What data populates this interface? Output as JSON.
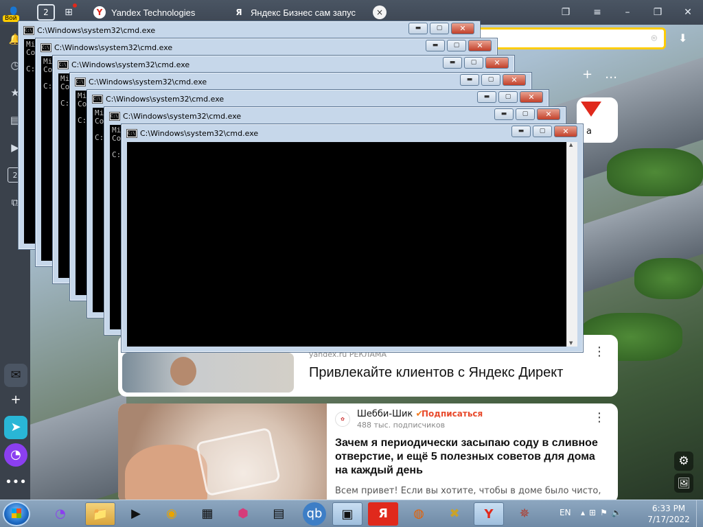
{
  "browser": {
    "tabs": [
      {
        "title": "Yandex Technologies",
        "favicon": "Y"
      },
      {
        "title": "Яндекс Бизнес сам запус",
        "favicon": "Я"
      }
    ],
    "tab_count": "2",
    "profile_badge": "Вой",
    "close_tab_icon": "×"
  },
  "sidebar": {
    "count_badge": "2"
  },
  "cmd_windows": [
    {
      "title": "C:\\Windows\\system32\\cmd.exe",
      "text": "Mi\nCo\n\nC:"
    },
    {
      "title": "C:\\Windows\\system32\\cmd.exe",
      "text": "Mi\nCo\n\nC:"
    },
    {
      "title": "C:\\Windows\\system32\\cmd.exe",
      "text": "Mi\nCo\n\nC:"
    },
    {
      "title": "C:\\Windows\\system32\\cmd.exe",
      "text": "Mi\nCo\n\nC:"
    },
    {
      "title": "C:\\Windows\\system32\\cmd.exe",
      "text": "Mi\nCo\n\nC:"
    },
    {
      "title": "C:\\Windows\\system32\\cmd.exe",
      "text": "Mi\nCo\n\nC:"
    },
    {
      "title": "C:\\Windows\\system32\\cmd.exe",
      "text": ""
    }
  ],
  "zen": {
    "small_card_text": "а",
    "ad": {
      "source": "yandex.ru  РЕКЛАМА",
      "title": "Привлекайте клиентов с Яндекс Директ"
    },
    "article": {
      "channel": "Шебби-Шик",
      "subscribe": "Подписаться",
      "subscribers": "488 тыс. подписчиков",
      "title": "Зачем я периодически засыпаю соду в сливное отверстие, и ещё 5 полезных советов для дома на каждый день",
      "snippet": "Всем привет! Если вы хотите, чтобы в доме было чисто, и"
    }
  },
  "taskbar": {
    "language": "EN",
    "time": "6:33 PM",
    "date": "7/17/2022"
  },
  "colors": {
    "accent_yellow": "#ffcc00",
    "yandex_red": "#e0291c"
  }
}
